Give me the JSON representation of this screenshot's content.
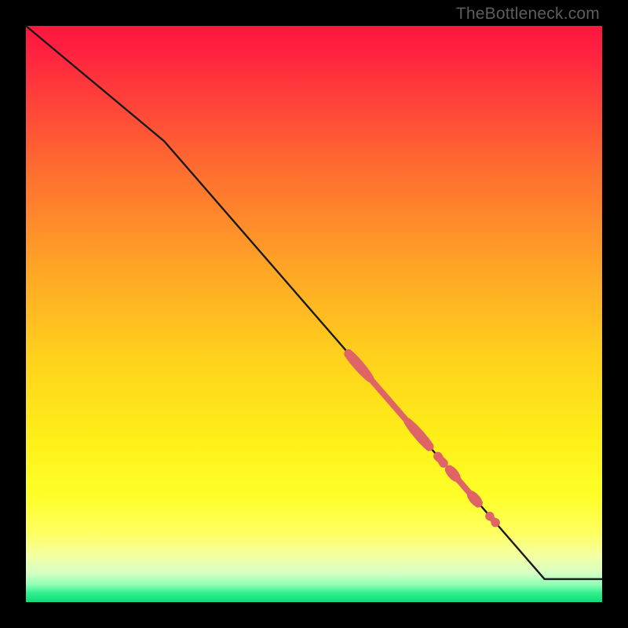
{
  "watermark": "TheBottleneck.com",
  "chart_data": {
    "type": "line",
    "title": "",
    "xlabel": "",
    "ylabel": "",
    "xlim": [
      0,
      100
    ],
    "ylim": [
      0,
      100
    ],
    "grid": false,
    "legend": false,
    "curve": [
      {
        "x": 0,
        "y": 100
      },
      {
        "x": 24,
        "y": 80
      },
      {
        "x": 90,
        "y": 4
      },
      {
        "x": 100,
        "y": 4
      }
    ],
    "dotted_segments": [
      {
        "x0": 56,
        "y0": 43.1,
        "x1": 70,
        "y1": 27.0
      },
      {
        "x0": 71.5,
        "y0": 25.3,
        "x1": 72.5,
        "y1": 24.1
      },
      {
        "x0": 73.5,
        "y0": 23.0,
        "x1": 78.5,
        "y1": 17.2
      },
      {
        "x0": 80.5,
        "y0": 14.9,
        "x1": 81.5,
        "y1": 13.8
      }
    ],
    "colors": {
      "curve": "#1a1a1a",
      "dots": "#de6466",
      "gradient_top": "#ff163e",
      "gradient_bottom": "#18d878"
    }
  }
}
